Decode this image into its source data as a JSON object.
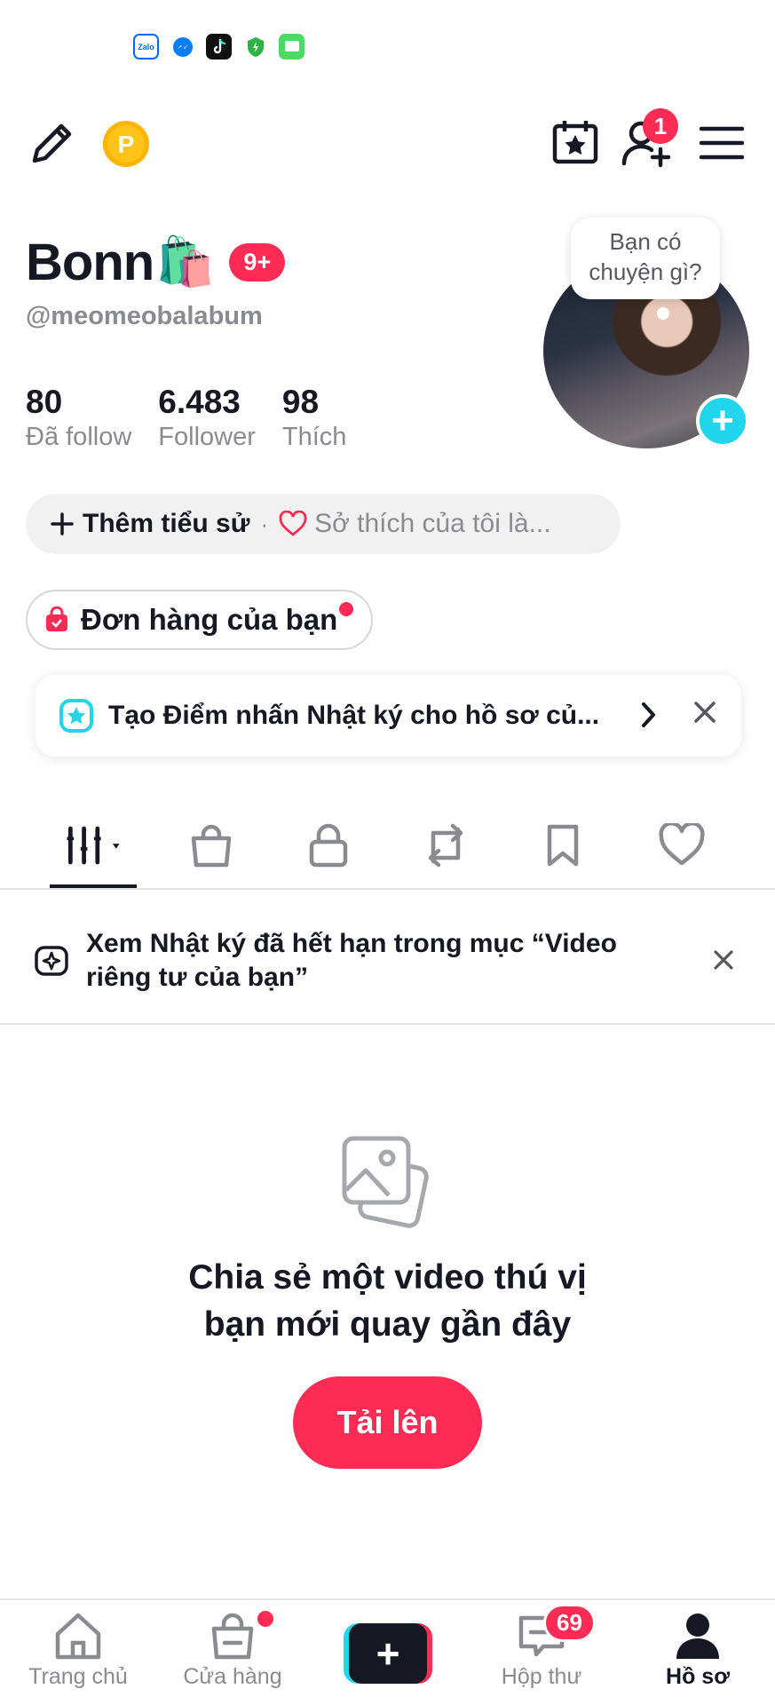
{
  "status_bar": {
    "icons": [
      "zalo-icon",
      "messenger-icon",
      "tiktok-icon",
      "shield-icon",
      "message-icon"
    ],
    "zalo_label": "Zalo"
  },
  "header": {
    "friend_request_count": "1"
  },
  "profile": {
    "name": "Bonn",
    "name_emoji": "🛍️",
    "notification_badge": "9+",
    "handle": "@meomeobalabum",
    "note_bubble": "Bạn có chuyện gì?",
    "stats": [
      {
        "value": "80",
        "label": "Đã follow"
      },
      {
        "value": "6.483",
        "label": "Follower"
      },
      {
        "value": "98",
        "label": "Thích"
      }
    ],
    "bio_add": "Thêm tiểu sử",
    "bio_sep": "·",
    "bio_hobby": "Sở thích của tôi là..."
  },
  "orders": {
    "label": "Đơn hàng của bạn"
  },
  "diary_prompt": {
    "label": "Tạo Điểm nhấn Nhật ký cho hồ sơ củ..."
  },
  "tabs": [
    "videos-grid",
    "shop-bag",
    "private-lock",
    "reposts",
    "bookmarks",
    "liked"
  ],
  "notice": {
    "text": "Xem Nhật ký đã hết hạn trong mục “Video riêng tư của bạn”"
  },
  "empty_state": {
    "line1": "Chia sẻ một video thú vị",
    "line2": "bạn mới quay gần đây",
    "button": "Tải lên"
  },
  "bottom_nav": {
    "home": "Trang chủ",
    "shop": "Cửa hàng",
    "create": "+",
    "inbox": "Hộp thư",
    "inbox_badge": "69",
    "profile": "Hồ sơ"
  },
  "colors": {
    "brand_red": "#fe2c55",
    "brand_cyan": "#20d5ec",
    "text": "#161823",
    "muted": "#8a8b91"
  }
}
